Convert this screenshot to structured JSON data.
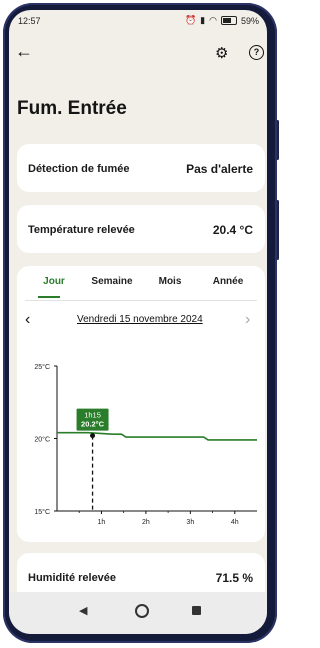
{
  "status": {
    "time": "12:57",
    "battery": "59%"
  },
  "header": {
    "title": "Fum. Entrée"
  },
  "smoke": {
    "label": "Détection de fumée",
    "value": "Pas d'alerte"
  },
  "temperature": {
    "label": "Température relevée",
    "value": "20.4 °C"
  },
  "tabs": [
    {
      "label": "Jour"
    },
    {
      "label": "Semaine"
    },
    {
      "label": "Mois"
    },
    {
      "label": "Année"
    }
  ],
  "date": {
    "label": "Vendredi 15 novembre 2024"
  },
  "tooltip": {
    "time": "1h15",
    "value": "20.2°C"
  },
  "humidity": {
    "label": "Humidité relevée",
    "value": "71.5 %"
  },
  "chart_data": {
    "type": "line",
    "x_ticks": [
      "1h",
      "2h",
      "3h",
      "4h"
    ],
    "y_ticks": [
      "25°C",
      "20°C",
      "15°C"
    ],
    "ylim": [
      15,
      25
    ],
    "xlim": [
      0,
      4.5
    ],
    "series": [
      {
        "x": [
          0,
          0.7,
          1.25,
          1.45,
          1.55,
          2.0,
          3.3,
          3.4,
          4.5
        ],
        "y": [
          20.4,
          20.4,
          20.3,
          20.3,
          20.1,
          20.1,
          20.1,
          19.9,
          19.9
        ]
      }
    ],
    "highlight": {
      "x": 0.8,
      "y": 20.2
    },
    "color": "#2a7d2a"
  }
}
